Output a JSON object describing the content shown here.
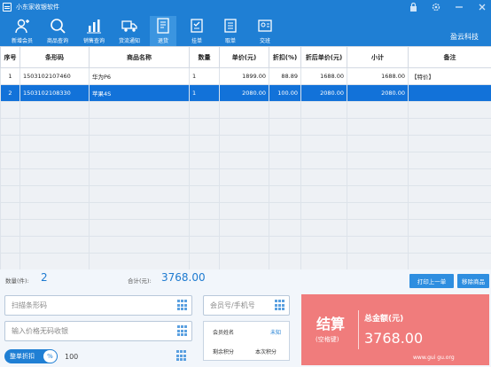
{
  "app": {
    "title": "小东家收银软件",
    "brand": "盈云科技"
  },
  "toolbar": [
    {
      "label": "新增会员",
      "icon": "person-add-icon"
    },
    {
      "label": "商品查询",
      "icon": "search-icon"
    },
    {
      "label": "销售查询",
      "icon": "bar-chart-icon"
    },
    {
      "label": "货流通知",
      "icon": "truck-icon"
    },
    {
      "label": "退货",
      "icon": "return-document-icon",
      "active": true
    },
    {
      "label": "挂单",
      "icon": "hang-order-icon"
    },
    {
      "label": "取单",
      "icon": "retrieve-order-icon"
    },
    {
      "label": "交班",
      "icon": "shift-change-icon"
    }
  ],
  "table": {
    "headers": [
      "序号",
      "条形码",
      "商品名称",
      "数量",
      "单价(元)",
      "折扣(%)",
      "折后单价(元)",
      "小计",
      "备注"
    ],
    "rows": [
      [
        "1",
        "1503102107460",
        "华为P6",
        "1",
        "1899.00",
        "88.89",
        "1688.00",
        "1688.00",
        "【特价】"
      ],
      [
        "2",
        "1503102108330",
        "苹果4S",
        "1",
        "2080.00",
        "100.00",
        "2080.00",
        "2080.00",
        ""
      ]
    ],
    "selected_row": 1
  },
  "summary": {
    "qty_label": "数量(件):",
    "qty_value": "2",
    "total_label": "合计(元):",
    "total_value": "3768.00",
    "print_button": "打印上一单",
    "remove_button": "移除商品"
  },
  "inputs": {
    "barcode_placeholder": "扫描条形码",
    "price_placeholder": "输入价格无码收银",
    "member_placeholder": "会员号/手机号"
  },
  "discount": {
    "toggle_label": "整单折扣",
    "pct_symbol": "%",
    "value": "100"
  },
  "member_info": {
    "name_label": "会员姓名",
    "name_value": "未知",
    "remain_label": "剩余积分",
    "this_label": "本次积分"
  },
  "checkout": {
    "label": "结算",
    "hint": "(空格键)",
    "total_label": "总金额(元)",
    "total_value": "3768.00"
  },
  "watermark": "www.gui gu.org",
  "colors": {
    "primary": "#1f7fd4",
    "selected_row": "#1272d9",
    "checkout": "#f07c7c"
  }
}
